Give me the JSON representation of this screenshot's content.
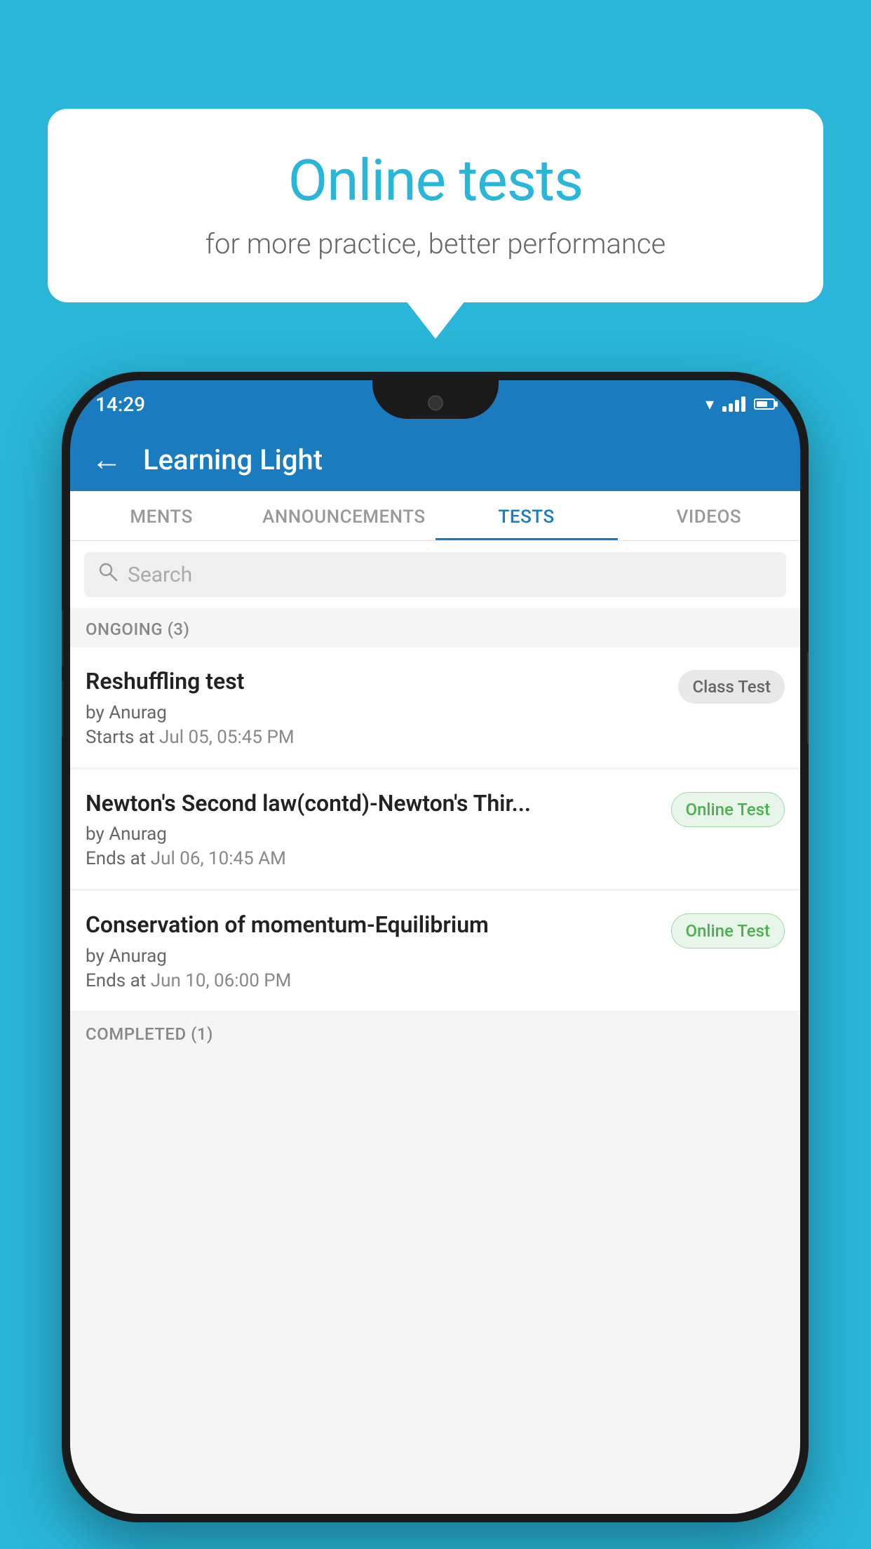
{
  "background_color": "#29b6d8",
  "bubble": {
    "title": "Online tests",
    "subtitle": "for more practice, better performance"
  },
  "status_bar": {
    "time": "14:29"
  },
  "app_header": {
    "title": "Learning Light",
    "back_label": "←"
  },
  "tabs": [
    {
      "id": "ments",
      "label": "MENTS",
      "active": false
    },
    {
      "id": "announcements",
      "label": "ANNOUNCEMENTS",
      "active": false
    },
    {
      "id": "tests",
      "label": "TESTS",
      "active": true
    },
    {
      "id": "videos",
      "label": "VIDEOS",
      "active": false
    }
  ],
  "search": {
    "placeholder": "Search"
  },
  "sections": [
    {
      "label": "ONGOING (3)",
      "tests": [
        {
          "name": "Reshuffling test",
          "author": "by Anurag",
          "time_label": "Starts at",
          "time_value": "Jul 05, 05:45 PM",
          "badge": "Class Test",
          "badge_type": "class"
        },
        {
          "name": "Newton's Second law(contd)-Newton's Thir...",
          "author": "by Anurag",
          "time_label": "Ends at",
          "time_value": "Jul 06, 10:45 AM",
          "badge": "Online Test",
          "badge_type": "online"
        },
        {
          "name": "Conservation of momentum-Equilibrium",
          "author": "by Anurag",
          "time_label": "Ends at",
          "time_value": "Jun 10, 06:00 PM",
          "badge": "Online Test",
          "badge_type": "online"
        }
      ]
    }
  ],
  "bottom_section_label": "COMPLETED (1)"
}
